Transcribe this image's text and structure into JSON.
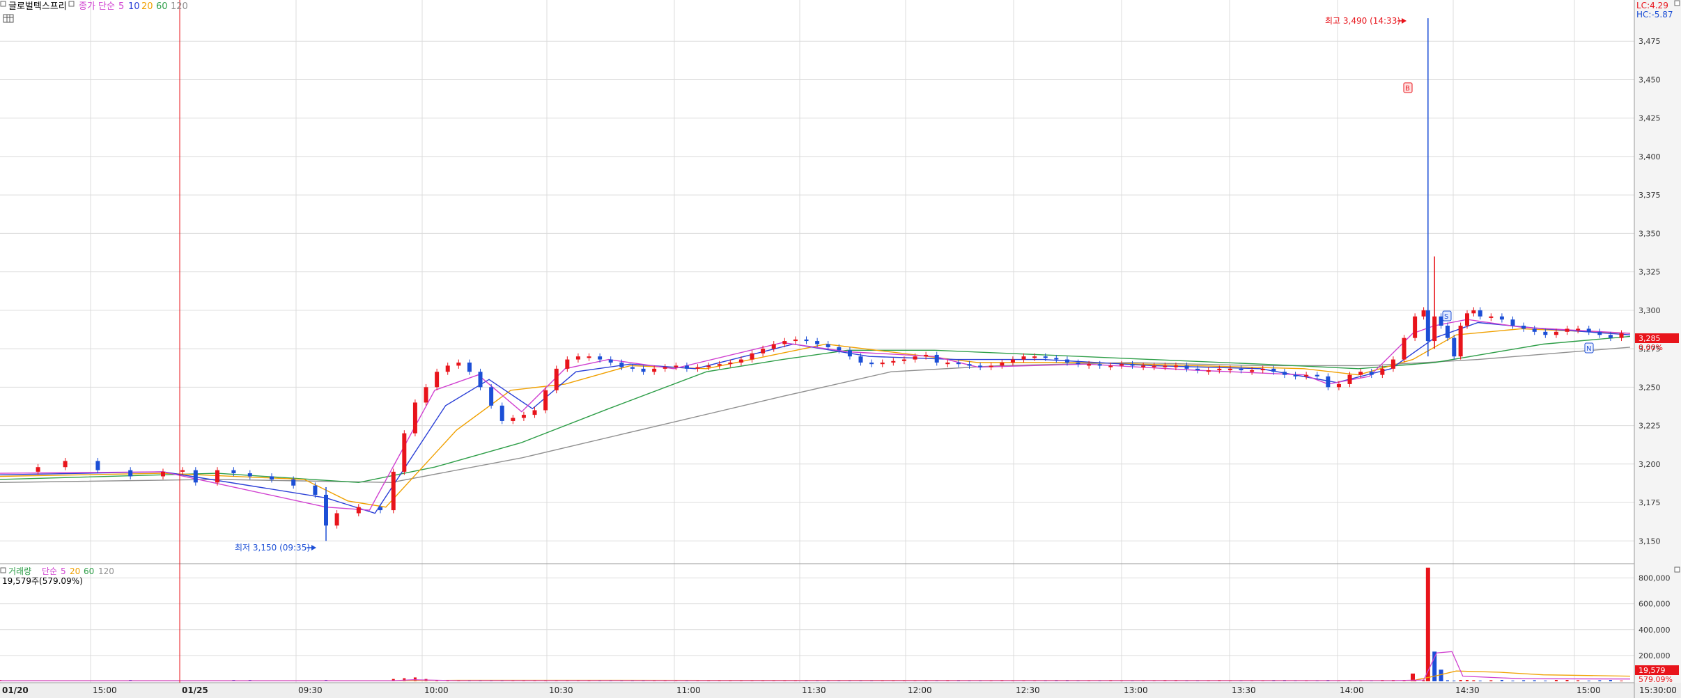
{
  "header": {
    "stock_name": "글로벌텍스프리",
    "price_title": "종가",
    "ma_type": "단순",
    "ma_periods": [
      "5",
      "10",
      "20",
      "60",
      "120"
    ],
    "lc": "LC:4.29",
    "hc": "HC:-5.87"
  },
  "volume_header": {
    "title": "거래량",
    "ma_type": "단순",
    "ma_periods": [
      "5",
      "20",
      "60",
      "120"
    ],
    "current_line": "19,579주(579.09%)"
  },
  "colors": {
    "up": "#e8141b",
    "down": "#1c4fd6",
    "ma5": "#d040d0",
    "ma10": "#2a3fd6",
    "ma20": "#f0a000",
    "ma60": "#2e9e48",
    "ma120": "#909090",
    "grid": "#dcdcdc"
  },
  "annotations": {
    "high": "최고 3,490 (14:33)",
    "low": "최저 3,150 (09:35)",
    "marker_b": "B",
    "marker_s": "S",
    "marker_n": "N"
  },
  "right_labels": {
    "price_current": "3,285",
    "price_change": "0.00%",
    "volume_current": "19,579",
    "volume_change": "579.09%"
  },
  "chart_data": [
    {
      "type": "candlestick",
      "title": "",
      "y_ticks": [
        "3,150",
        "3,175",
        "3,200",
        "3,225",
        "3,250",
        "3,275",
        "3,300",
        "3,325",
        "3,350",
        "3,375",
        "3,400",
        "3,425",
        "3,450",
        "3,475"
      ],
      "ylim": [
        3137,
        3500
      ],
      "x_ticks": [
        "01/20",
        "15:00",
        "01/25",
        "09:30",
        "10:00",
        "10:30",
        "11:00",
        "11:30",
        "12:00",
        "12:30",
        "13:00",
        "13:30",
        "14:00",
        "14:30",
        "15:00",
        "15:30:00"
      ],
      "grid": true,
      "session_divider": "01/25",
      "high": 3490,
      "high_time": "14:33",
      "low": 3150,
      "low_time": "09:35",
      "last_close": 3285,
      "close_series_approx": [
        [
          0,
          3195
        ],
        [
          35,
          3198
        ],
        [
          60,
          3202
        ],
        [
          90,
          3196
        ],
        [
          120,
          3192
        ],
        [
          150,
          3195
        ],
        [
          168,
          3196
        ],
        [
          180,
          3188
        ],
        [
          200,
          3196
        ],
        [
          215,
          3194
        ],
        [
          230,
          3192
        ],
        [
          250,
          3190
        ],
        [
          270,
          3186
        ],
        [
          290,
          3180
        ],
        [
          300,
          3160
        ],
        [
          310,
          3168
        ],
        [
          330,
          3172
        ],
        [
          350,
          3170
        ],
        [
          362,
          3195
        ],
        [
          372,
          3220
        ],
        [
          382,
          3240
        ],
        [
          392,
          3250
        ],
        [
          402,
          3260
        ],
        [
          412,
          3264
        ],
        [
          422,
          3266
        ],
        [
          432,
          3260
        ],
        [
          442,
          3250
        ],
        [
          452,
          3238
        ],
        [
          462,
          3228
        ],
        [
          472,
          3230
        ],
        [
          482,
          3232
        ],
        [
          492,
          3235
        ],
        [
          502,
          3248
        ],
        [
          512,
          3262
        ],
        [
          522,
          3268
        ],
        [
          532,
          3270
        ],
        [
          542,
          3270
        ],
        [
          552,
          3268
        ],
        [
          562,
          3266
        ],
        [
          572,
          3263
        ],
        [
          582,
          3262
        ],
        [
          592,
          3260
        ],
        [
          602,
          3262
        ],
        [
          612,
          3263
        ],
        [
          622,
          3264
        ],
        [
          632,
          3262
        ],
        [
          642,
          3263
        ],
        [
          652,
          3264
        ],
        [
          662,
          3265
        ],
        [
          672,
          3266
        ],
        [
          682,
          3268
        ],
        [
          692,
          3272
        ],
        [
          702,
          3275
        ],
        [
          712,
          3278
        ],
        [
          722,
          3280
        ],
        [
          732,
          3281
        ],
        [
          742,
          3280
        ],
        [
          752,
          3278
        ],
        [
          762,
          3276
        ],
        [
          772,
          3274
        ],
        [
          782,
          3270
        ],
        [
          792,
          3266
        ],
        [
          802,
          3265
        ],
        [
          812,
          3266
        ],
        [
          822,
          3267
        ],
        [
          832,
          3268
        ],
        [
          842,
          3270
        ],
        [
          852,
          3271
        ],
        [
          862,
          3266
        ],
        [
          872,
          3266
        ],
        [
          882,
          3265
        ],
        [
          892,
          3264
        ],
        [
          902,
          3263
        ],
        [
          912,
          3264
        ],
        [
          922,
          3266
        ],
        [
          932,
          3268
        ],
        [
          942,
          3270
        ],
        [
          952,
          3270
        ],
        [
          962,
          3269
        ],
        [
          972,
          3268
        ],
        [
          982,
          3266
        ],
        [
          992,
          3265
        ],
        [
          1002,
          3265
        ],
        [
          1012,
          3264
        ],
        [
          1022,
          3264
        ],
        [
          1032,
          3265
        ],
        [
          1042,
          3264
        ],
        [
          1052,
          3264
        ],
        [
          1062,
          3264
        ],
        [
          1072,
          3264
        ],
        [
          1082,
          3264
        ],
        [
          1092,
          3262
        ],
        [
          1102,
          3261
        ],
        [
          1112,
          3261
        ],
        [
          1122,
          3262
        ],
        [
          1132,
          3262
        ],
        [
          1142,
          3261
        ],
        [
          1152,
          3261
        ],
        [
          1162,
          3262
        ],
        [
          1172,
          3260
        ],
        [
          1182,
          3258
        ],
        [
          1192,
          3257
        ],
        [
          1202,
          3258
        ],
        [
          1212,
          3257
        ],
        [
          1222,
          3250
        ],
        [
          1232,
          3252
        ],
        [
          1242,
          3258
        ],
        [
          1252,
          3260
        ],
        [
          1262,
          3258
        ],
        [
          1272,
          3262
        ],
        [
          1282,
          3268
        ],
        [
          1292,
          3282
        ],
        [
          1302,
          3296
        ],
        [
          1310,
          3300
        ],
        [
          1314,
          3280
        ],
        [
          1320,
          3296
        ],
        [
          1326,
          3290
        ],
        [
          1332,
          3282
        ],
        [
          1338,
          3270
        ],
        [
          1344,
          3290
        ],
        [
          1350,
          3298
        ],
        [
          1356,
          3300
        ],
        [
          1362,
          3296
        ],
        [
          1372,
          3296
        ],
        [
          1382,
          3294
        ],
        [
          1392,
          3290
        ],
        [
          1402,
          3288
        ],
        [
          1412,
          3286
        ],
        [
          1422,
          3284
        ],
        [
          1432,
          3286
        ],
        [
          1442,
          3288
        ],
        [
          1452,
          3288
        ],
        [
          1462,
          3286
        ],
        [
          1472,
          3284
        ],
        [
          1482,
          3282
        ],
        [
          1492,
          3285
        ]
      ],
      "ma5_approx": [
        [
          0,
          3194
        ],
        [
          150,
          3195
        ],
        [
          300,
          3172
        ],
        [
          340,
          3170
        ],
        [
          400,
          3248
        ],
        [
          440,
          3258
        ],
        [
          480,
          3234
        ],
        [
          520,
          3262
        ],
        [
          560,
          3268
        ],
        [
          620,
          3262
        ],
        [
          720,
          3279
        ],
        [
          780,
          3273
        ],
        [
          860,
          3270
        ],
        [
          900,
          3263
        ],
        [
          1000,
          3265
        ],
        [
          1100,
          3261
        ],
        [
          1200,
          3258
        ],
        [
          1222,
          3252
        ],
        [
          1260,
          3257
        ],
        [
          1300,
          3285
        ],
        [
          1320,
          3290
        ],
        [
          1350,
          3294
        ],
        [
          1400,
          3289
        ],
        [
          1450,
          3287
        ],
        [
          1500,
          3285
        ]
      ],
      "ma10_approx": [
        [
          0,
          3193
        ],
        [
          150,
          3195
        ],
        [
          300,
          3178
        ],
        [
          345,
          3168
        ],
        [
          410,
          3238
        ],
        [
          450,
          3255
        ],
        [
          490,
          3236
        ],
        [
          530,
          3260
        ],
        [
          580,
          3265
        ],
        [
          640,
          3262
        ],
        [
          730,
          3278
        ],
        [
          800,
          3270
        ],
        [
          880,
          3268
        ],
        [
          960,
          3268
        ],
        [
          1060,
          3264
        ],
        [
          1160,
          3262
        ],
        [
          1230,
          3253
        ],
        [
          1280,
          3262
        ],
        [
          1320,
          3282
        ],
        [
          1360,
          3292
        ],
        [
          1420,
          3288
        ],
        [
          1500,
          3284
        ]
      ],
      "ma20_approx": [
        [
          0,
          3192
        ],
        [
          150,
          3194
        ],
        [
          280,
          3190
        ],
        [
          320,
          3176
        ],
        [
          355,
          3172
        ],
        [
          420,
          3222
        ],
        [
          470,
          3248
        ],
        [
          520,
          3252
        ],
        [
          580,
          3264
        ],
        [
          650,
          3262
        ],
        [
          760,
          3278
        ],
        [
          830,
          3272
        ],
        [
          900,
          3266
        ],
        [
          1000,
          3266
        ],
        [
          1100,
          3264
        ],
        [
          1200,
          3262
        ],
        [
          1250,
          3258
        ],
        [
          1300,
          3268
        ],
        [
          1340,
          3284
        ],
        [
          1400,
          3288
        ],
        [
          1500,
          3285
        ]
      ],
      "ma60_approx": [
        [
          0,
          3190
        ],
        [
          200,
          3194
        ],
        [
          330,
          3188
        ],
        [
          400,
          3198
        ],
        [
          480,
          3214
        ],
        [
          560,
          3236
        ],
        [
          650,
          3260
        ],
        [
          720,
          3268
        ],
        [
          780,
          3274
        ],
        [
          860,
          3274
        ],
        [
          960,
          3271
        ],
        [
          1060,
          3268
        ],
        [
          1160,
          3265
        ],
        [
          1250,
          3262
        ],
        [
          1320,
          3266
        ],
        [
          1420,
          3278
        ],
        [
          1500,
          3283
        ]
      ],
      "ma120_approx": [
        [
          0,
          3188
        ],
        [
          200,
          3190
        ],
        [
          360,
          3188
        ],
        [
          480,
          3204
        ],
        [
          600,
          3224
        ],
        [
          720,
          3244
        ],
        [
          820,
          3260
        ],
        [
          920,
          3264
        ],
        [
          1040,
          3266
        ],
        [
          1160,
          3264
        ],
        [
          1260,
          3264
        ],
        [
          1360,
          3268
        ],
        [
          1500,
          3276
        ]
      ]
    },
    {
      "type": "bar",
      "title": "",
      "y_ticks": [
        "200,000",
        "400,000",
        "600,000",
        "800,000"
      ],
      "ylim": [
        0,
        900000
      ],
      "peak_volume": 880000,
      "current_volume": 19579
    }
  ]
}
